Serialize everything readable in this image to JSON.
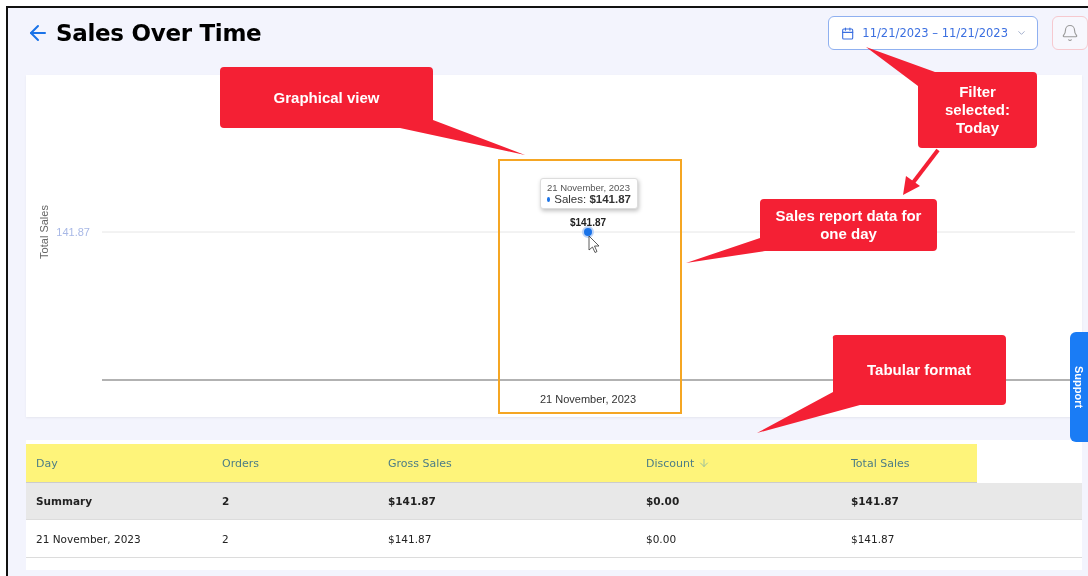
{
  "header": {
    "title": "Sales Over Time",
    "date_range": "11/21/2023 – 11/21/2023"
  },
  "chart": {
    "highlight_box": true,
    "y_axis_title": "Total Sales",
    "y_tick_label": "141.87",
    "x_label": "21 November, 2023",
    "point_label": "$141.87",
    "tooltip": {
      "date": "21 November, 2023",
      "line": "Sales: **$141.87**"
    }
  },
  "table": {
    "header_highlighted": true,
    "columns": [
      {
        "label": "Day",
        "sorted": false
      },
      {
        "label": "Orders",
        "sorted": false
      },
      {
        "label": "Gross Sales",
        "sorted": false
      },
      {
        "label": "Discount",
        "sorted": true
      },
      {
        "label": "Total Sales",
        "sorted": false
      }
    ],
    "rows": [
      {
        "kind": "summary",
        "cells": [
          "Summary",
          "2",
          "$141.87",
          "$0.00",
          "$141.87"
        ]
      },
      {
        "kind": "data",
        "cells": [
          "21 November, 2023",
          "2",
          "$141.87",
          "$0.00",
          "$141.87"
        ]
      }
    ]
  },
  "support_tab": "Support",
  "annotations": [
    {
      "kind": "callout",
      "text": "Graphical view"
    },
    {
      "kind": "callout",
      "text": "Filter selected: Today"
    },
    {
      "kind": "arrow"
    },
    {
      "kind": "callout",
      "text": "Sales report data for one day"
    },
    {
      "kind": "callout",
      "text": "Tabular format"
    }
  ]
}
